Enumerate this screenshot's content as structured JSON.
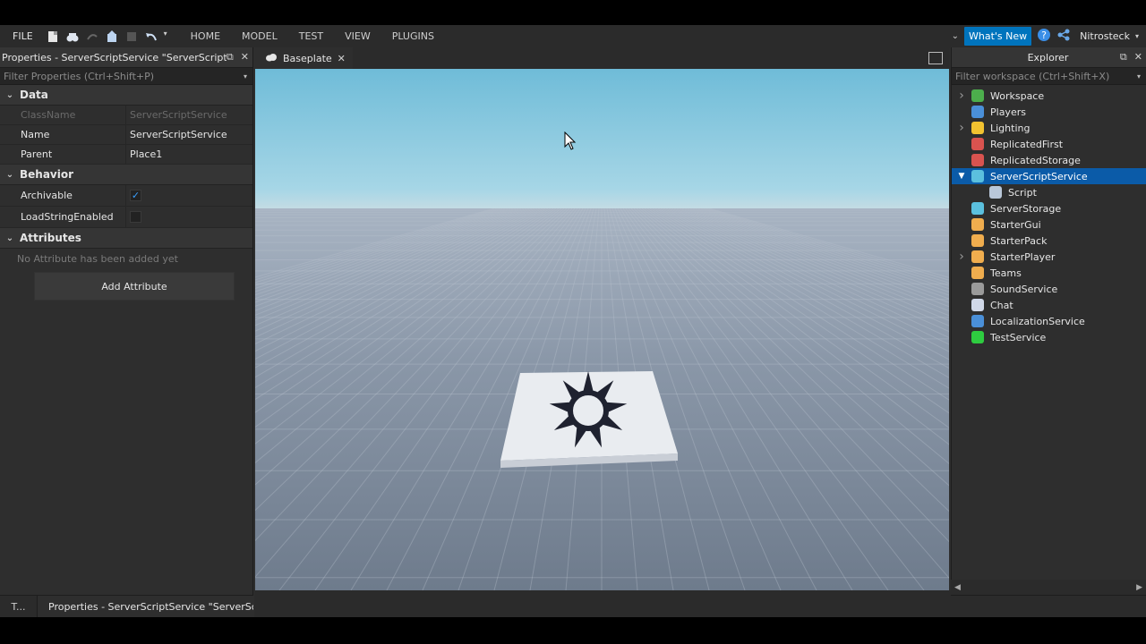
{
  "menubar": {
    "file": "FILE",
    "tabs": [
      "HOME",
      "MODEL",
      "TEST",
      "VIEW",
      "PLUGINS"
    ],
    "whats_new": "What's New",
    "username": "Nitrosteck"
  },
  "properties": {
    "title": "Properties - ServerScriptService \"ServerScriptService\"",
    "filter_placeholder": "Filter Properties (Ctrl+Shift+P)",
    "sections": {
      "data": "Data",
      "behavior": "Behavior",
      "attributes": "Attributes"
    },
    "rows": {
      "classname_k": "ClassName",
      "classname_v": "ServerScriptService",
      "name_k": "Name",
      "name_v": "ServerScriptService",
      "parent_k": "Parent",
      "parent_v": "Place1",
      "archivable_k": "Archivable",
      "loadstring_k": "LoadStringEnabled"
    },
    "archivable": true,
    "loadstring_enabled": false,
    "no_attr": "No Attribute has been added yet",
    "add_attr": "Add Attribute"
  },
  "bottom_tabs": {
    "short": "T...",
    "active": "Properties - ServerScriptService \"ServerScri..."
  },
  "viewport": {
    "tab": "Baseplate"
  },
  "explorer": {
    "title": "Explorer",
    "filter_placeholder": "Filter workspace (Ctrl+Shift+X)",
    "items": [
      {
        "label": "Workspace",
        "expand": "right",
        "color": "#4cae4c",
        "name": "workspace"
      },
      {
        "label": "Players",
        "expand": "",
        "color": "#4a8fd8",
        "name": "players"
      },
      {
        "label": "Lighting",
        "expand": "right",
        "color": "#f2c230",
        "name": "lighting"
      },
      {
        "label": "ReplicatedFirst",
        "expand": "",
        "color": "#d9534f",
        "name": "replicatedfirst"
      },
      {
        "label": "ReplicatedStorage",
        "expand": "",
        "color": "#d9534f",
        "name": "replicatedstorage"
      },
      {
        "label": "ServerScriptService",
        "expand": "down",
        "color": "#5bc0de",
        "name": "serverscriptservice",
        "selected": true
      },
      {
        "label": "Script",
        "expand": "",
        "color": "#b9c7d9",
        "name": "script",
        "child": true
      },
      {
        "label": "ServerStorage",
        "expand": "",
        "color": "#5bc0de",
        "name": "serverstorage"
      },
      {
        "label": "StarterGui",
        "expand": "",
        "color": "#f0ad4e",
        "name": "startergui"
      },
      {
        "label": "StarterPack",
        "expand": "",
        "color": "#f0ad4e",
        "name": "starterpack"
      },
      {
        "label": "StarterPlayer",
        "expand": "right",
        "color": "#f0ad4e",
        "name": "starterplayer"
      },
      {
        "label": "Teams",
        "expand": "",
        "color": "#f0ad4e",
        "name": "teams"
      },
      {
        "label": "SoundService",
        "expand": "",
        "color": "#9a9a9a",
        "name": "soundservice"
      },
      {
        "label": "Chat",
        "expand": "",
        "color": "#d0d8e8",
        "name": "chat"
      },
      {
        "label": "LocalizationService",
        "expand": "",
        "color": "#4a8fd8",
        "name": "localizationservice"
      },
      {
        "label": "TestService",
        "expand": "",
        "color": "#2ecc40",
        "name": "testservice"
      }
    ]
  }
}
